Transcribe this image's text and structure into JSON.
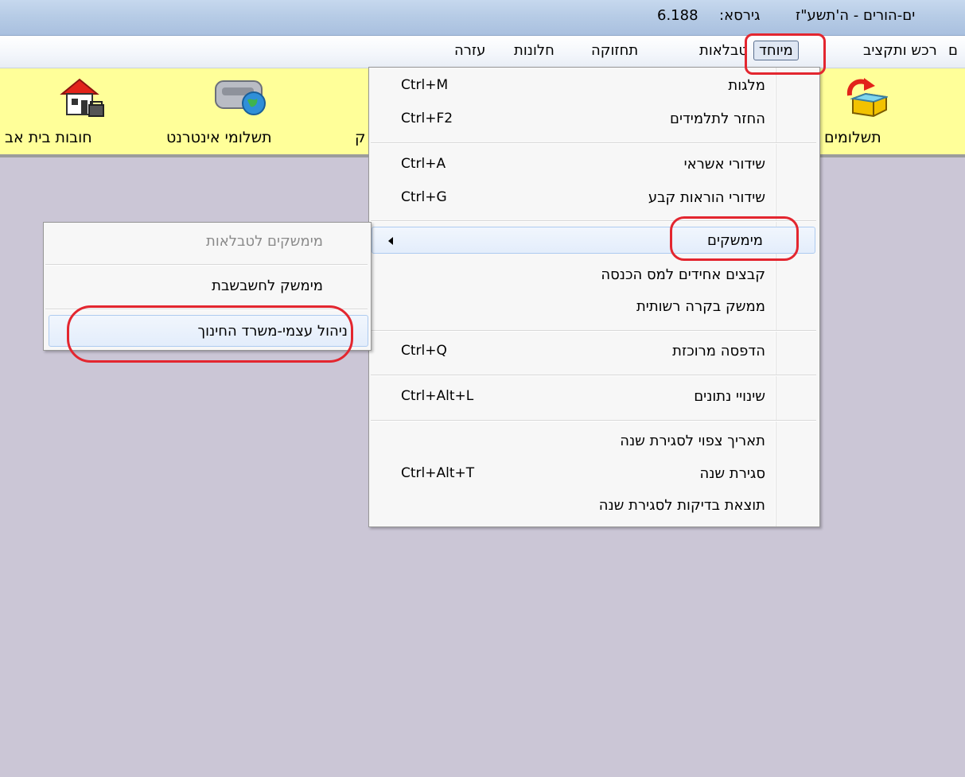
{
  "titlebar": {
    "app_title": "ים-הורים - ה'תשע\"ז",
    "version_label": "גירסא:",
    "version_number": "6.188"
  },
  "menubar": {
    "items": [
      {
        "label": "ם"
      },
      {
        "label": "רכש ותקציב"
      },
      {
        "label": "מיוחד"
      },
      {
        "label": "טבלאות"
      },
      {
        "label": "תחזוקה"
      },
      {
        "label": "חלונות"
      },
      {
        "label": "עזרה"
      }
    ],
    "active": "מיוחד"
  },
  "toolbar": {
    "buttons": [
      {
        "label": "תשלומים",
        "icon": "payments-box-icon"
      },
      {
        "label": "ק",
        "icon": ""
      },
      {
        "label": "תשלומי אינטרנט",
        "icon": "internet-payments-icon"
      },
      {
        "label": "חובות בית אב",
        "icon": "household-debts-icon"
      }
    ]
  },
  "dropdown": {
    "items": [
      {
        "label": "מלגות",
        "shortcut": "Ctrl+M"
      },
      {
        "label": "החזר לתלמידים",
        "shortcut": "Ctrl+F2"
      },
      {
        "label": "שידורי אשראי",
        "shortcut": "Ctrl+A"
      },
      {
        "label": "שידורי הוראות קבע",
        "shortcut": "Ctrl+G"
      },
      {
        "label": "מימשקים",
        "shortcut": ""
      },
      {
        "label": "קבצים אחידים למס הכנסה",
        "shortcut": ""
      },
      {
        "label": "ממשק בקרה רשותית",
        "shortcut": ""
      },
      {
        "label": "הדפסה מרוכזת",
        "shortcut": "Ctrl+Q"
      },
      {
        "label": "שינויי נתונים",
        "shortcut": "Ctrl+Alt+L"
      },
      {
        "label": "תאריך צפוי לסגירת שנה",
        "shortcut": ""
      },
      {
        "label": "סגירת שנה",
        "shortcut": "Ctrl+Alt+T"
      },
      {
        "label": "תוצאת בדיקות לסגירת שנה",
        "shortcut": ""
      }
    ]
  },
  "submenu": {
    "items": [
      {
        "label": "מימשקים לטבלאות",
        "enabled": false
      },
      {
        "label": "מימשק לחשבשבת",
        "enabled": true
      },
      {
        "label": "ניהול עצמי-משרד החינוך",
        "enabled": true
      }
    ]
  },
  "colors": {
    "annotation_red": "#e3262f",
    "toolbar_yellow": "#ffff99",
    "workspace": "#cbc6d6"
  }
}
